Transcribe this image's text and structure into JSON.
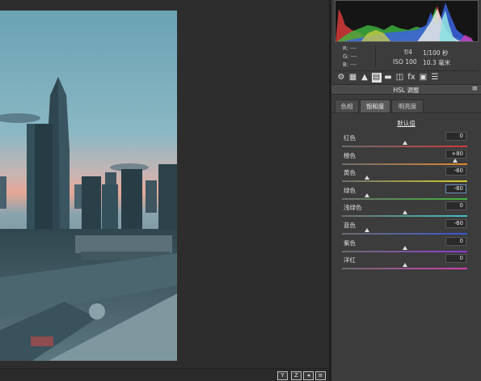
{
  "photo": {
    "description_icon": "city-skyline-photo"
  },
  "bottom_bar": {
    "buttons": [
      "Y",
      "Z",
      "◂",
      "≡"
    ]
  },
  "histogram": {
    "icon": "histogram-chart"
  },
  "info": {
    "r_label": "R:",
    "r_value": "---",
    "g_label": "G:",
    "g_value": "---",
    "b_label": "B:",
    "b_value": "---",
    "aperture": "f/4",
    "shutter": "1/100 秒",
    "iso": "ISO 100",
    "focal": "10.3 毫米"
  },
  "tools": [
    {
      "name": "gear-icon",
      "glyph": "⚙"
    },
    {
      "name": "tone-curve-icon",
      "glyph": "▦"
    },
    {
      "name": "detail-icon",
      "glyph": "▲"
    },
    {
      "name": "hsl-icon",
      "glyph": "▤",
      "active": true
    },
    {
      "name": "split-toning-icon",
      "glyph": "▬"
    },
    {
      "name": "lens-icon",
      "glyph": "◫"
    },
    {
      "name": "fx-icon",
      "glyph": "fx"
    },
    {
      "name": "camera-calibration-icon",
      "glyph": "▣"
    },
    {
      "name": "presets-icon",
      "glyph": "☰"
    }
  ],
  "panel": {
    "title": "HSL 调整",
    "menu_glyph": "≡"
  },
  "tabs": [
    {
      "label": "色相",
      "selected": false
    },
    {
      "label": "饱和度",
      "selected": true
    },
    {
      "label": "明亮度",
      "selected": false
    }
  ],
  "defaults_label": "默认值",
  "sliders": [
    {
      "id": "red",
      "label": "红色",
      "value": "0",
      "num": 0,
      "gradient": [
        "#6d6d6d",
        "#d23a3a"
      ]
    },
    {
      "id": "orange",
      "label": "橙色",
      "value": "+80",
      "num": 80,
      "gradient": [
        "#6d6d6d",
        "#e0862d"
      ]
    },
    {
      "id": "yellow",
      "label": "黄色",
      "value": "-60",
      "num": -60,
      "gradient": [
        "#6d6d6d",
        "#d8cc2c"
      ]
    },
    {
      "id": "green",
      "label": "绿色",
      "value": "-60",
      "num": -60,
      "gradient": [
        "#6d6d6d",
        "#43b23b"
      ],
      "focused": true
    },
    {
      "id": "aqua",
      "label": "浅绿色",
      "value": "0",
      "num": 0,
      "gradient": [
        "#6d6d6d",
        "#3cc0c0"
      ]
    },
    {
      "id": "blue",
      "label": "蓝色",
      "value": "-60",
      "num": -60,
      "gradient": [
        "#6d6d6d",
        "#3a56d6"
      ]
    },
    {
      "id": "purple",
      "label": "紫色",
      "value": "0",
      "num": 0,
      "gradient": [
        "#6d6d6d",
        "#8a3ad6"
      ]
    },
    {
      "id": "magenta",
      "label": "洋红",
      "value": "0",
      "num": 0,
      "gradient": [
        "#6d6d6d",
        "#d23ab0"
      ]
    }
  ]
}
